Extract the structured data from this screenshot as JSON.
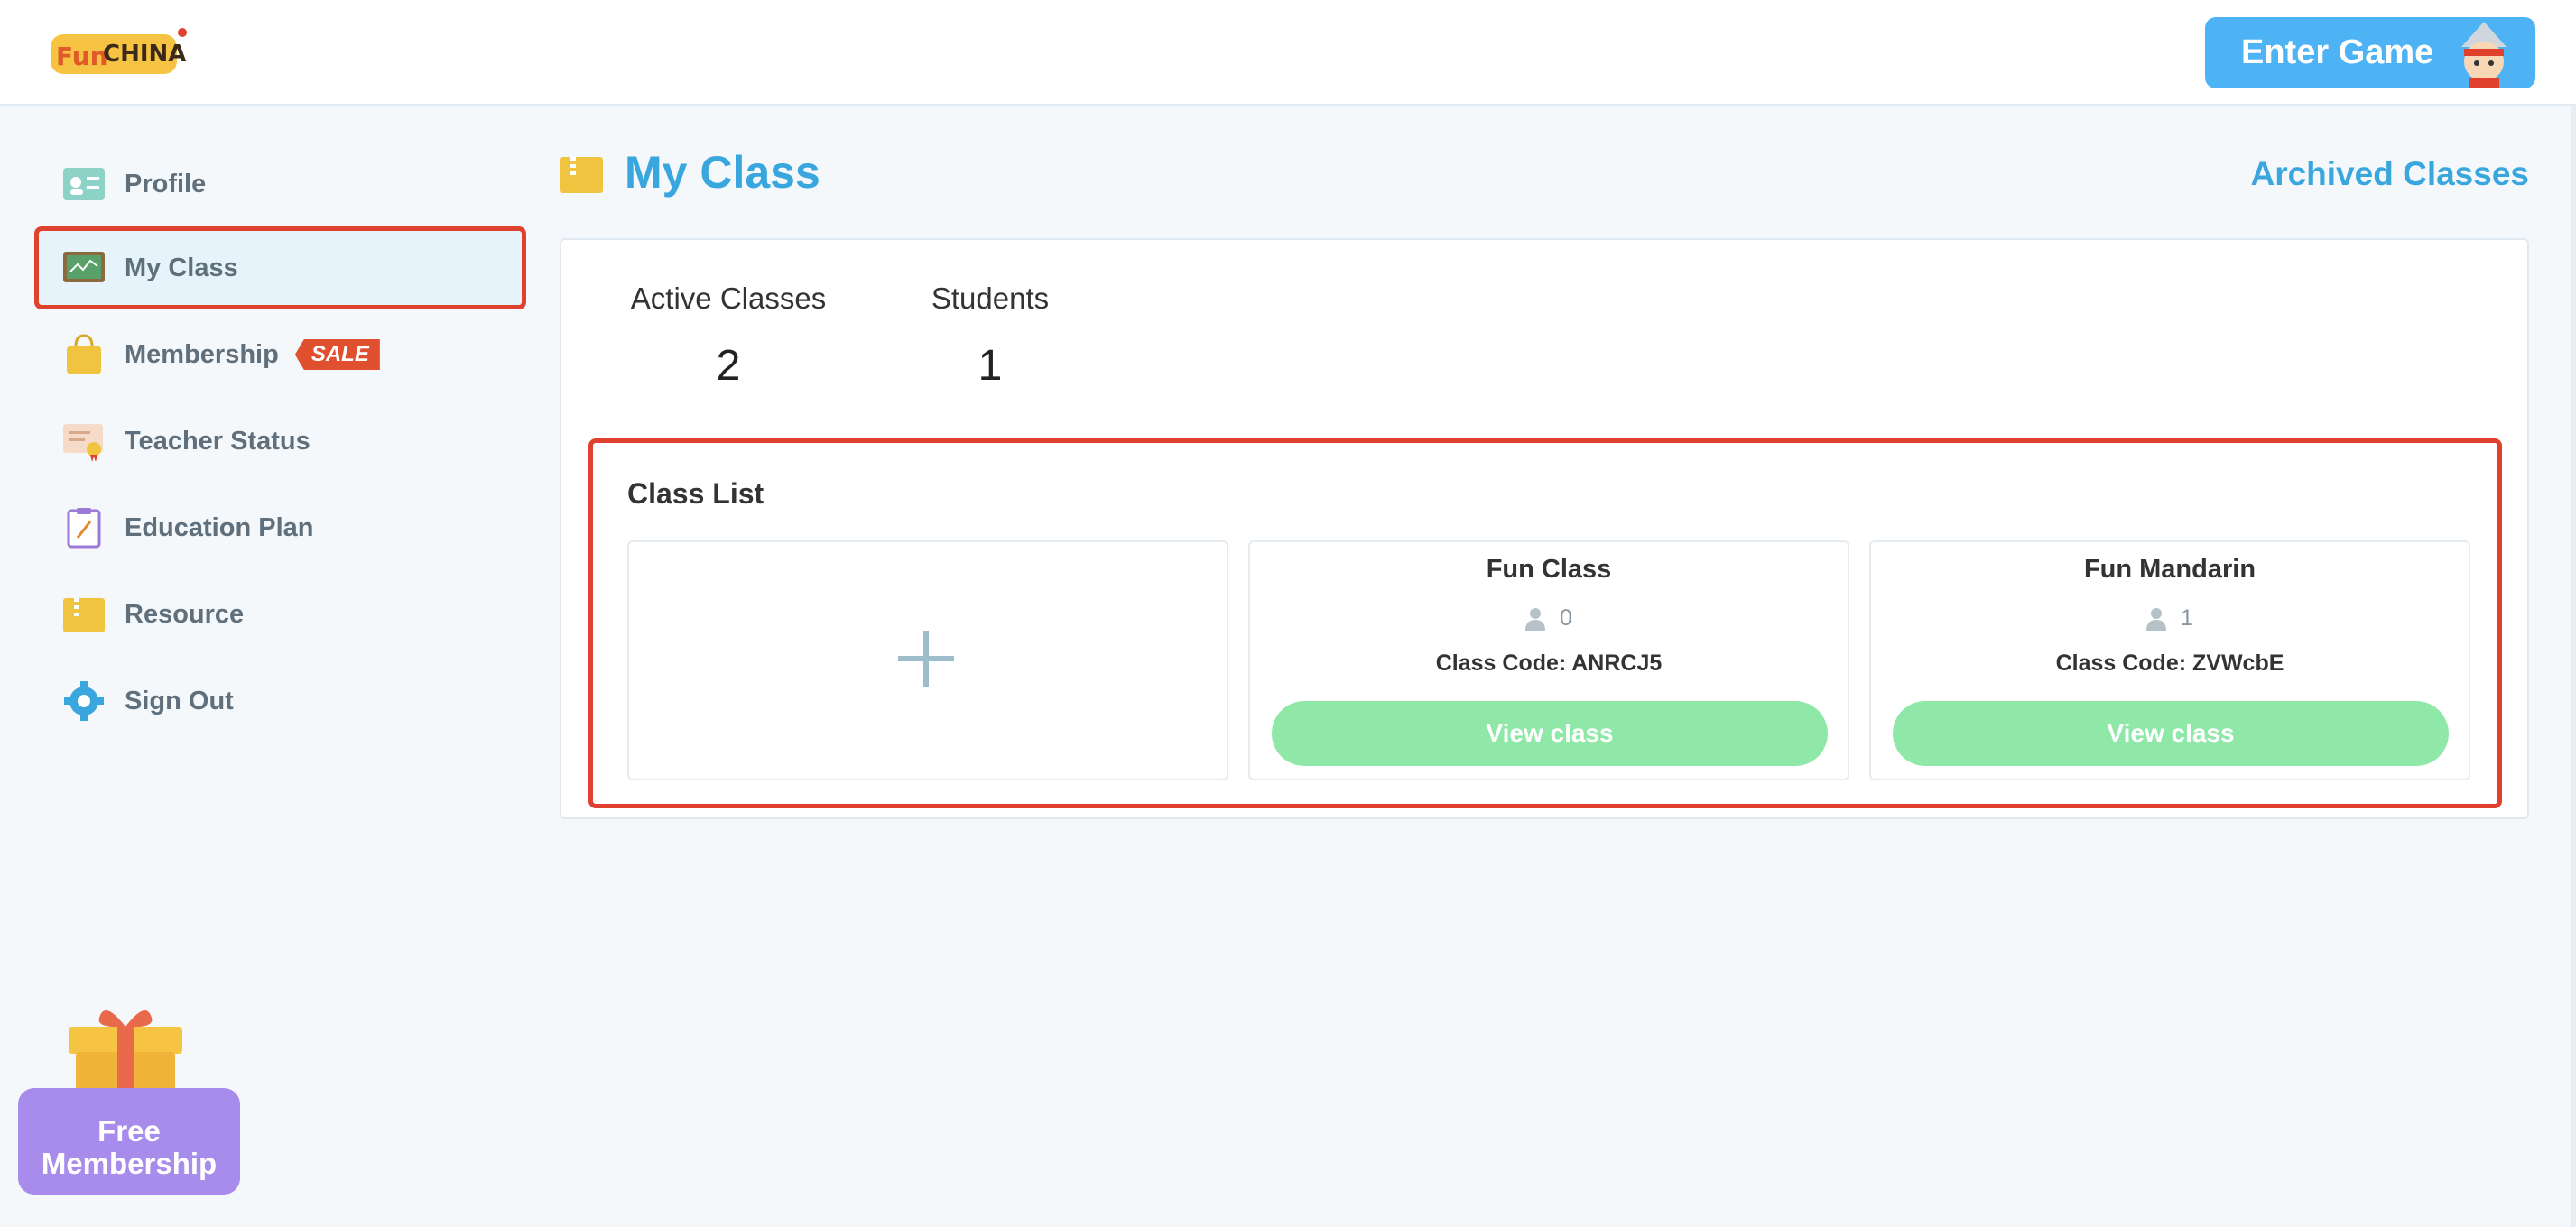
{
  "header": {
    "logo_text": "FunChina",
    "enter_game_label": "Enter Game"
  },
  "sidebar": {
    "items": [
      {
        "label": "Profile",
        "icon": "profile-card-icon"
      },
      {
        "label": "My Class",
        "icon": "chalkboard-icon",
        "active": true
      },
      {
        "label": "Membership",
        "icon": "shopping-bag-icon",
        "badge": "SALE"
      },
      {
        "label": "Teacher Status",
        "icon": "certificate-icon"
      },
      {
        "label": "Education Plan",
        "icon": "clipboard-icon"
      },
      {
        "label": "Resource",
        "icon": "folder-zip-icon"
      },
      {
        "label": "Sign Out",
        "icon": "gear-icon"
      }
    ],
    "free_membership_line1": "Free",
    "free_membership_line2": "Membership"
  },
  "main": {
    "title": "My Class",
    "archived_label": "Archived Classes",
    "stats": {
      "active_label": "Active Classes",
      "active_value": "2",
      "students_label": "Students",
      "students_value": "1"
    },
    "class_list": {
      "title": "Class List",
      "classes": [
        {
          "name": "Fun Class",
          "students": "0",
          "code": "Class Code: ANRCJ5",
          "button": "View class"
        },
        {
          "name": "Fun Mandarin",
          "students": "1",
          "code": "Class Code: ZVWcbE",
          "button": "View class"
        }
      ]
    }
  },
  "colors": {
    "accent_blue": "#3aa6de",
    "button_blue": "#4db3f4",
    "view_green": "#8fe8a8",
    "highlight_red": "#e0412e",
    "promo_purple": "#a78ceb"
  }
}
